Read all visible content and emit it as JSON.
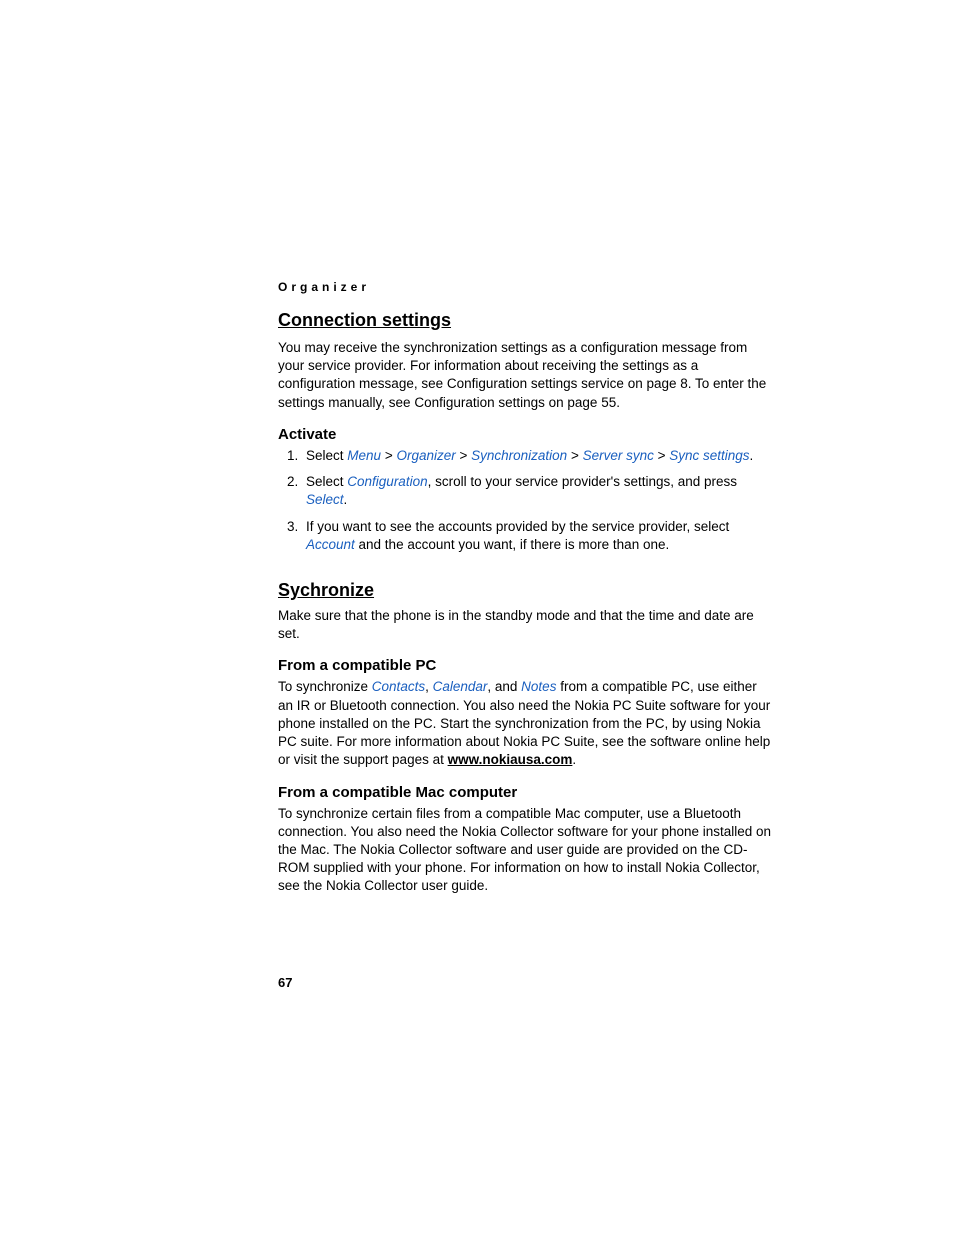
{
  "header": {
    "running": "Organizer"
  },
  "s1": {
    "title": "Connection settings",
    "intro": "You may receive the synchronization settings as a configuration message from your service provider. For information about receiving the settings as a configuration message, see Configuration settings service on page 8. To enter the settings manually, see Configuration settings on page 55.",
    "activate": {
      "heading": "Activate",
      "step1_a": "Select ",
      "step1_menu": "Menu",
      "step1_sep": " > ",
      "step1_org": "Organizer",
      "step1_sync": "Synchronization",
      "step1_server": "Server sync",
      "step1_settings": "Sync settings",
      "step1_end": ".",
      "step2_a": "Select ",
      "step2_config": "Configuration",
      "step2_b": ", scroll to your service provider's settings, and press ",
      "step2_select": "Select",
      "step2_end": ".",
      "step3_a": "If you want to see the accounts provided by the service provider, select ",
      "step3_account": "Account",
      "step3_b": " and the account you want, if there is more than one."
    }
  },
  "s2": {
    "title": "Sychronize",
    "intro": "Make sure that the phone is in the standby mode and that the time and date are set.",
    "pc": {
      "heading": "From a compatible PC",
      "a": "To synchronize ",
      "contacts": "Contacts",
      "sep1": ", ",
      "calendar": "Calendar",
      "sep2": ", and ",
      "notes": "Notes",
      "b": " from a compatible PC, use either an IR or Bluetooth connection. You also need the Nokia PC Suite software for your phone installed on the PC. Start the synchronization from the PC, by using Nokia PC suite. For more information about Nokia PC Suite, see the software online help or visit the support pages at ",
      "url": "www.nokiausa.com",
      "c": "."
    },
    "mac": {
      "heading": "From a compatible Mac computer",
      "body": "To synchronize certain files from a compatible Mac computer, use a Bluetooth connection. You also need the Nokia Collector software for your phone installed on the Mac. The Nokia Collector software and user guide are provided on the CD-ROM supplied with your phone. For information on how to install Nokia Collector, see the Nokia Collector user guide."
    }
  },
  "page_number": "67"
}
